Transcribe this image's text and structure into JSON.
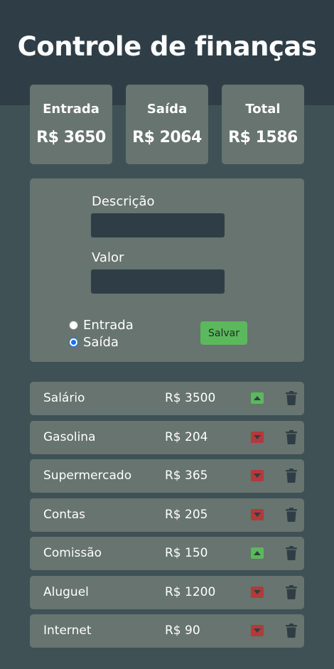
{
  "title": "Controle de finanças",
  "summary": [
    {
      "label": "Entrada",
      "value": "R$ 3650"
    },
    {
      "label": "Saída",
      "value": "R$ 2064"
    },
    {
      "label": "Total",
      "value": "R$ 1586"
    }
  ],
  "form": {
    "description_label": "Descrição",
    "description_value": "",
    "amount_label": "Valor",
    "amount_value": "",
    "radio_in_label": "Entrada",
    "radio_out_label": "Saída",
    "selected_type": "Saída",
    "save_label": "Salvar"
  },
  "transactions": [
    {
      "description": "Salário",
      "amount": "R$ 3500",
      "type": "up",
      "type_icon": "arrow-up-icon"
    },
    {
      "description": "Gasolina",
      "amount": "R$ 204",
      "type": "down",
      "type_icon": "arrow-down-icon"
    },
    {
      "description": "Supermercado",
      "amount": "R$ 365",
      "type": "down",
      "type_icon": "arrow-down-icon"
    },
    {
      "description": "Contas",
      "amount": "R$ 205",
      "type": "down",
      "type_icon": "arrow-down-icon"
    },
    {
      "description": "Comissão",
      "amount": "R$ 150",
      "type": "up",
      "type_icon": "arrow-up-icon"
    },
    {
      "description": "Aluguel",
      "amount": "R$ 1200",
      "type": "down",
      "type_icon": "arrow-down-icon"
    },
    {
      "description": "Internet",
      "amount": "R$ 90",
      "type": "down",
      "type_icon": "arrow-down-icon"
    }
  ],
  "colors": {
    "header_bg": "#2f3e46",
    "page_bg": "#3f5155",
    "card_bg": "#67746f",
    "input_bg": "#2f3e46",
    "income": "#5cb85c",
    "expense": "#b33a3a",
    "trash": "#2f3e46"
  }
}
